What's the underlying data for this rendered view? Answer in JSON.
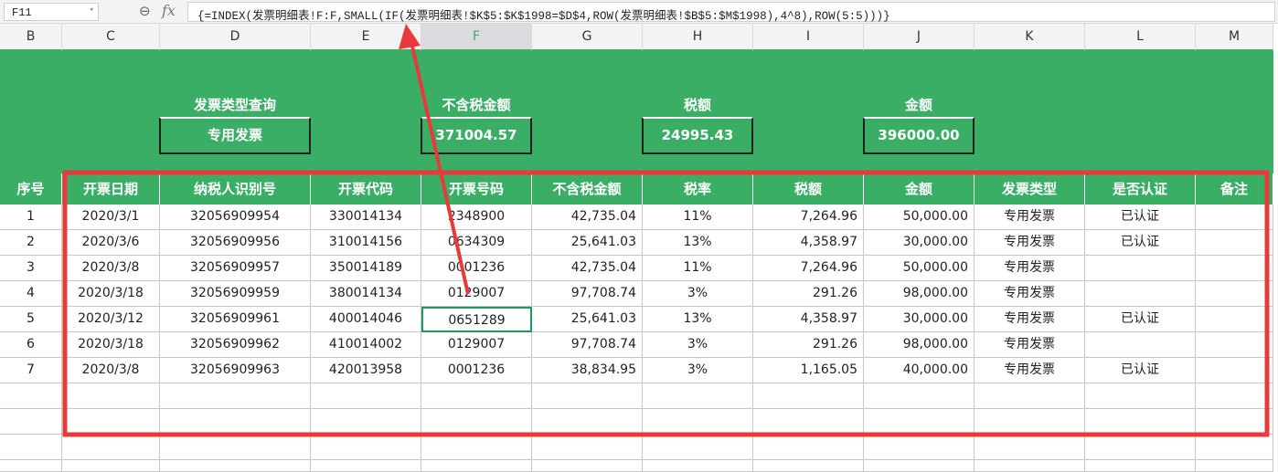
{
  "formula_bar": {
    "name_box": "F11",
    "formula": "{=INDEX(发票明细表!F:F,SMALL(IF(发票明细表!$K$5:$K$1998=$D$4,ROW(发票明细表!$B$5:$M$1998),4^8),ROW(5:5)))}"
  },
  "columns": [
    "B",
    "C",
    "D",
    "E",
    "F",
    "G",
    "H",
    "I",
    "J",
    "K",
    "L",
    "M"
  ],
  "summary": {
    "type_label": "发票类型查询",
    "type_value": "专用发票",
    "pretax_label": "不含税金额",
    "pretax_value": "371004.57",
    "tax_label": "税额",
    "tax_value": "24995.43",
    "amount_label": "金额",
    "amount_value": "396000.00"
  },
  "table": {
    "headers": [
      "序号",
      "开票日期",
      "纳税人识别号",
      "开票代码",
      "开票号码",
      "不含税金额",
      "税率",
      "税额",
      "金额",
      "发票类型",
      "是否认证",
      "备注"
    ],
    "rows": [
      [
        "1",
        "2020/3/1",
        "32056909954",
        "330014134",
        "2348900",
        "42,735.04",
        "11%",
        "7,264.96",
        "50,000.00",
        "专用发票",
        "已认证",
        ""
      ],
      [
        "2",
        "2020/3/6",
        "32056909956",
        "310014156",
        "0634309",
        "25,641.03",
        "13%",
        "4,358.97",
        "30,000.00",
        "专用发票",
        "已认证",
        ""
      ],
      [
        "3",
        "2020/3/8",
        "32056909957",
        "350014189",
        "0001236",
        "42,735.04",
        "11%",
        "7,264.96",
        "50,000.00",
        "专用发票",
        "",
        ""
      ],
      [
        "4",
        "2020/3/18",
        "32056909959",
        "380014134",
        "0129007",
        "97,708.74",
        "3%",
        "291.26",
        "98,000.00",
        "专用发票",
        "",
        ""
      ],
      [
        "5",
        "2020/3/12",
        "32056909961",
        "400014046",
        "0651289",
        "25,641.03",
        "13%",
        "4,358.97",
        "30,000.00",
        "专用发票",
        "已认证",
        ""
      ],
      [
        "6",
        "2020/3/18",
        "32056909962",
        "410014002",
        "0129007",
        "97,708.74",
        "3%",
        "291.26",
        "98,000.00",
        "专用发票",
        "",
        ""
      ],
      [
        "7",
        "2020/3/8",
        "32056909963",
        "420013958",
        "0001236",
        "38,834.95",
        "3%",
        "1,165.05",
        "40,000.00",
        "专用发票",
        "已认证",
        ""
      ]
    ]
  },
  "colors": {
    "accent": "#3aae64",
    "annotation": "#e83a3a"
  }
}
